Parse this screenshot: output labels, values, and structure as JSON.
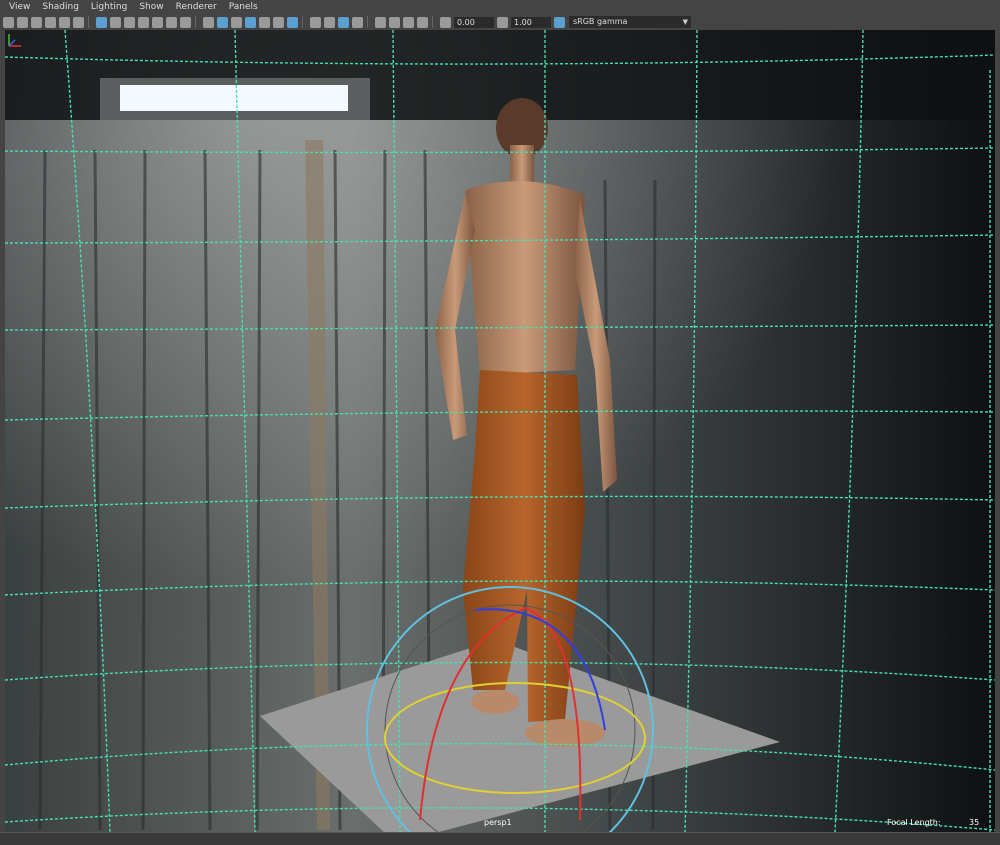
{
  "menubar": {
    "view": "View",
    "shading": "Shading",
    "lighting": "Lighting",
    "show": "Show",
    "renderer": "Renderer",
    "panels": "Panels"
  },
  "toolbar": {
    "exposure_value": "0.00",
    "gamma_value": "1.00",
    "color_space": "sRGB gamma"
  },
  "viewport": {
    "camera_name": "persp1",
    "focal_length_label": "Focal Length:",
    "focal_length_value": "35"
  },
  "colors": {
    "grid": "#46e0b0",
    "ground_plane": "#9a9a9a",
    "skin": "#c09070",
    "pants": "#b0602a",
    "manip_red": "#e03030",
    "manip_blue": "#3040e0",
    "manip_yellow": "#e0d030",
    "manip_cyan": "#60c0e0"
  }
}
